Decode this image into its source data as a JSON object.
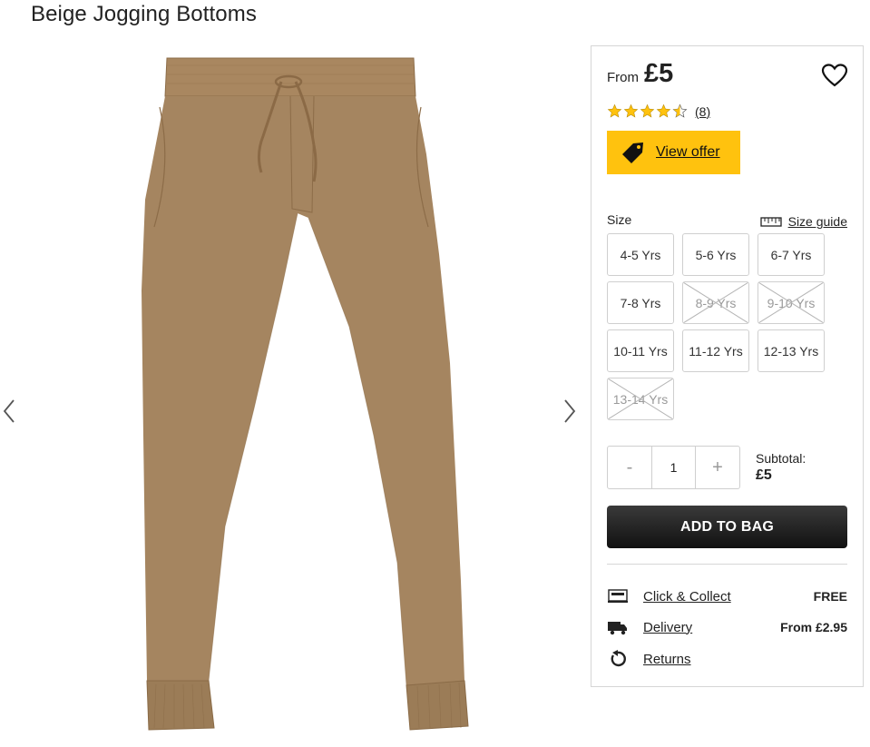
{
  "product": {
    "title": "Beige Jogging Bottoms"
  },
  "gallery": {
    "prev_icon": "chevron-left-icon",
    "next_icon": "chevron-right-icon",
    "image_color": "#a58560"
  },
  "price": {
    "from_label": "From",
    "amount": "£5"
  },
  "wishlist": {
    "icon": "heart-icon"
  },
  "rating": {
    "value": 4.5,
    "max": 5,
    "count_label": "(8)",
    "star_color": "#ffc20e"
  },
  "offer": {
    "label": "View offer",
    "icon": "price-tag-icon",
    "color": "#ffc20e"
  },
  "size": {
    "label": "Size",
    "guide_label": "Size guide",
    "guide_icon": "ruler-icon",
    "options": [
      {
        "label": "4-5 Yrs",
        "available": true
      },
      {
        "label": "5-6 Yrs",
        "available": true
      },
      {
        "label": "6-7 Yrs",
        "available": true
      },
      {
        "label": "7-8 Yrs",
        "available": true
      },
      {
        "label": "8-9 Yrs",
        "available": false
      },
      {
        "label": "9-10 Yrs",
        "available": false
      },
      {
        "label": "10-11 Yrs",
        "available": true
      },
      {
        "label": "11-12 Yrs",
        "available": true
      },
      {
        "label": "12-13 Yrs",
        "available": true
      },
      {
        "label": "13-14 Yrs",
        "available": false
      }
    ]
  },
  "quantity": {
    "decrement": "-",
    "value": "1",
    "increment": "+"
  },
  "subtotal": {
    "label": "Subtotal:",
    "value": "£5"
  },
  "add_to_bag": {
    "label": "ADD TO BAG"
  },
  "fulfilment": {
    "click_collect": {
      "label": "Click & Collect",
      "value": "FREE",
      "icon": "click-and-collect-icon"
    },
    "delivery": {
      "label": "Delivery",
      "value": "From £2.95",
      "icon": "delivery-truck-icon"
    },
    "returns": {
      "label": "Returns",
      "icon": "returns-icon"
    }
  }
}
